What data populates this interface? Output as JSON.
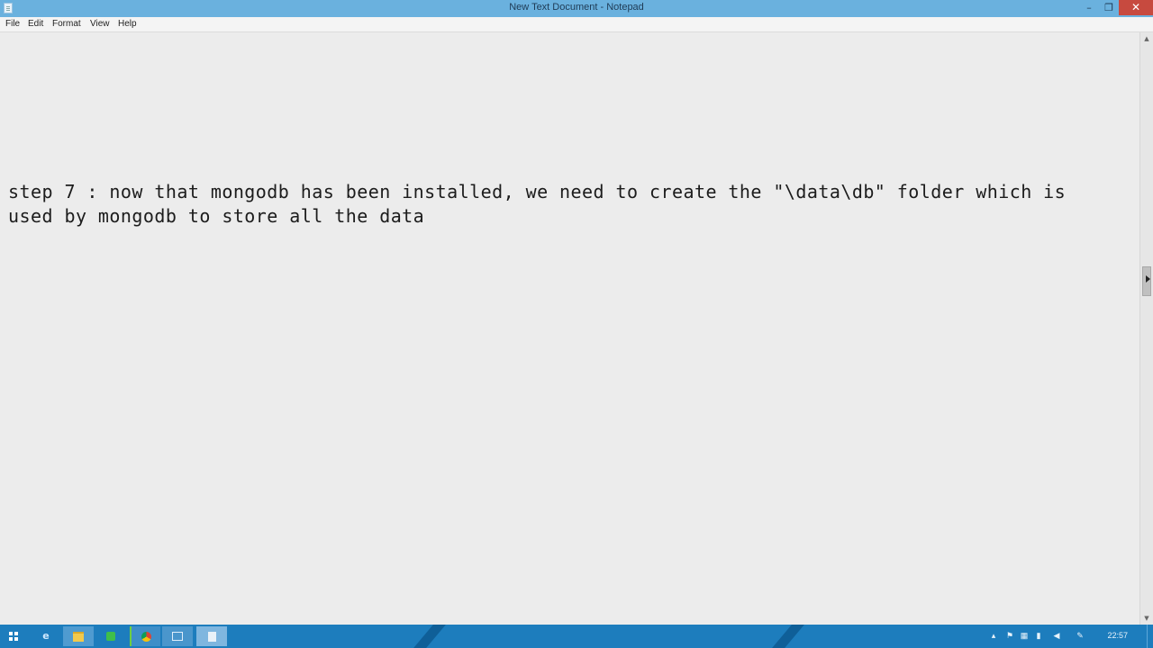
{
  "window": {
    "title": "New Text Document - Notepad",
    "minimize_glyph": "–",
    "maximize_glyph": "❐",
    "close_glyph": "✕"
  },
  "menu": {
    "items": [
      "File",
      "Edit",
      "Format",
      "View",
      "Help"
    ]
  },
  "editor": {
    "lines": [
      "step 7 : now that mongodb has been installed, we need to create the \"\\data\\db\" folder which is",
      "used by mongodb to store all the data"
    ]
  },
  "taskbar": {
    "clock": "22:57",
    "apps": [
      "start-icon",
      "internet-explorer-icon",
      "file-explorer-icon",
      "green-app-icon",
      "chrome-icon",
      "virtual-machine-icon",
      "notepad-icon"
    ]
  },
  "colors": {
    "titlebar": "#6ab1de",
    "close_button": "#c74a3f",
    "editor_background": "#ececec",
    "taskbar": "#1d7dbd"
  }
}
